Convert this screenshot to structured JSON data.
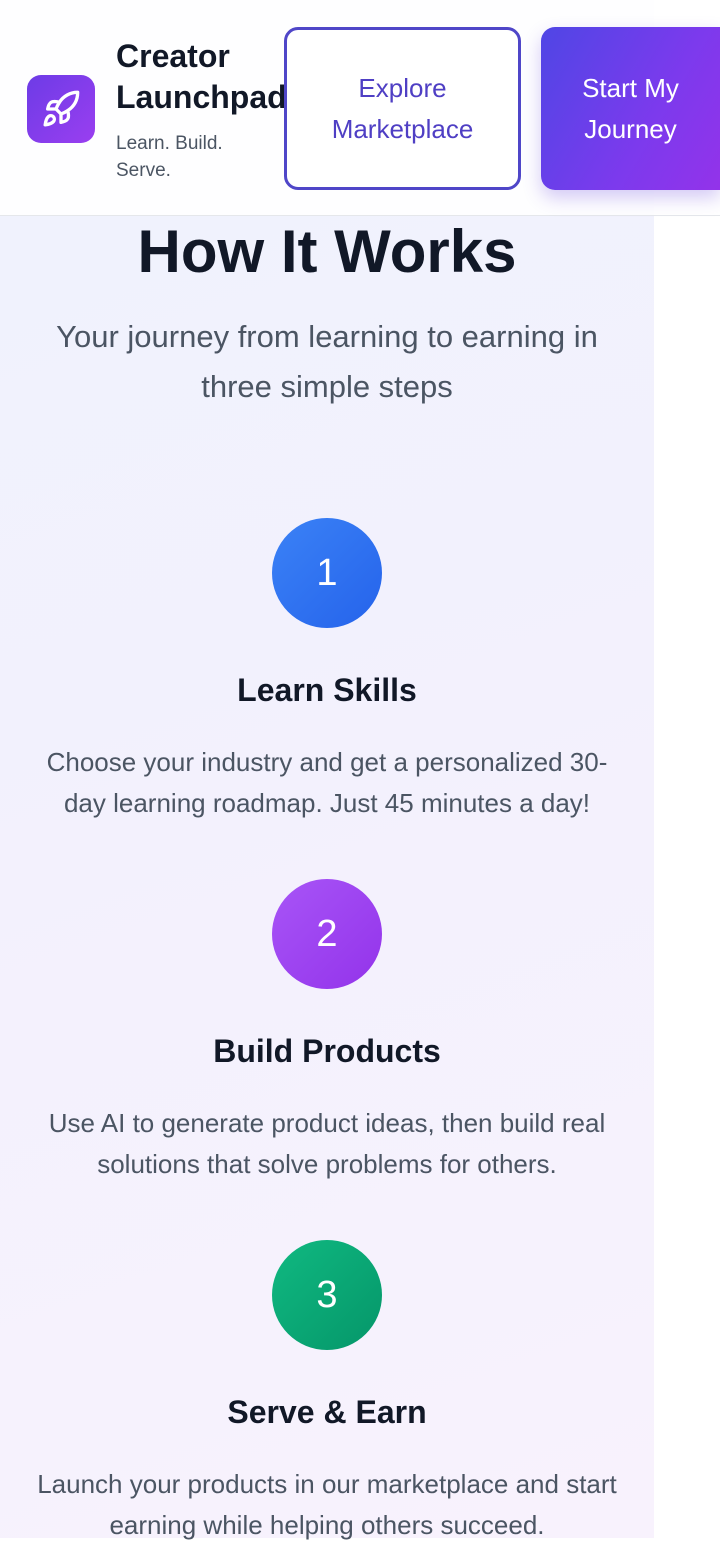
{
  "header": {
    "brand_name": "Creator Launchpad",
    "tagline": "Learn. Build. Serve.",
    "logo_icon": "rocket-icon",
    "explore_label": "Explore Marketplace",
    "start_label": "Start My Journey"
  },
  "how_it_works": {
    "title": "How It Works",
    "subtitle": "Your journey from learning to earning in three simple steps",
    "steps": [
      {
        "number": "1",
        "title": "Learn Skills",
        "description": "Choose your industry and get a personalized 30-day learning roadmap. Just 45 minutes a day!",
        "color": "#3b82f6"
      },
      {
        "number": "2",
        "title": "Build Products",
        "description": "Use AI to generate product ideas, then build real solutions that solve problems for others.",
        "color": "#a855f7"
      },
      {
        "number": "3",
        "title": "Serve & Earn",
        "description": "Launch your products in our marketplace and start earning while helping others succeed.",
        "color": "#10b981"
      }
    ]
  },
  "colors": {
    "brand_primary": "#4f46e5",
    "brand_secondary": "#9333ea"
  }
}
